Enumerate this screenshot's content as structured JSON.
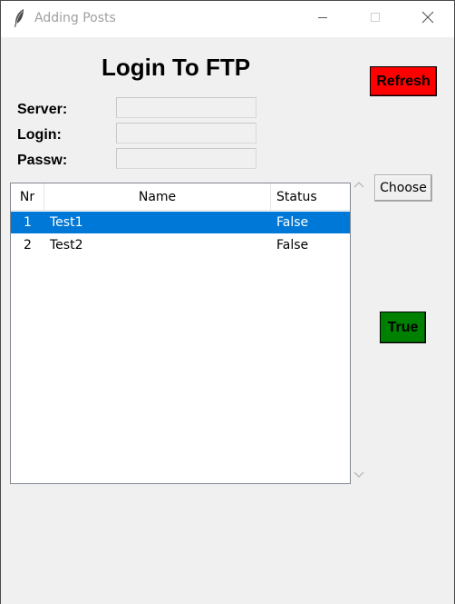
{
  "window": {
    "title": "Adding Posts",
    "app_icon": "feather-icon",
    "controls": [
      "minimize-icon",
      "maximize-icon",
      "close-icon"
    ]
  },
  "form": {
    "heading": "Login To FTP",
    "server_label": "Server:",
    "server_value": "",
    "login_label": "Login:",
    "login_value": "",
    "password_label": "Passw:",
    "password_value": ""
  },
  "buttons": {
    "refresh_label": "Refresh",
    "refresh_color": "#ff0000",
    "choose_label": "Choose",
    "true_label": "True",
    "true_color": "#008000"
  },
  "table": {
    "columns": [
      "Nr",
      "Name",
      "Status"
    ],
    "rows": [
      {
        "nr": "1",
        "name": "Test1",
        "status": "False",
        "selected": true
      },
      {
        "nr": "2",
        "name": "Test2",
        "status": "False",
        "selected": false
      }
    ],
    "selection_color": "#0078d7"
  }
}
